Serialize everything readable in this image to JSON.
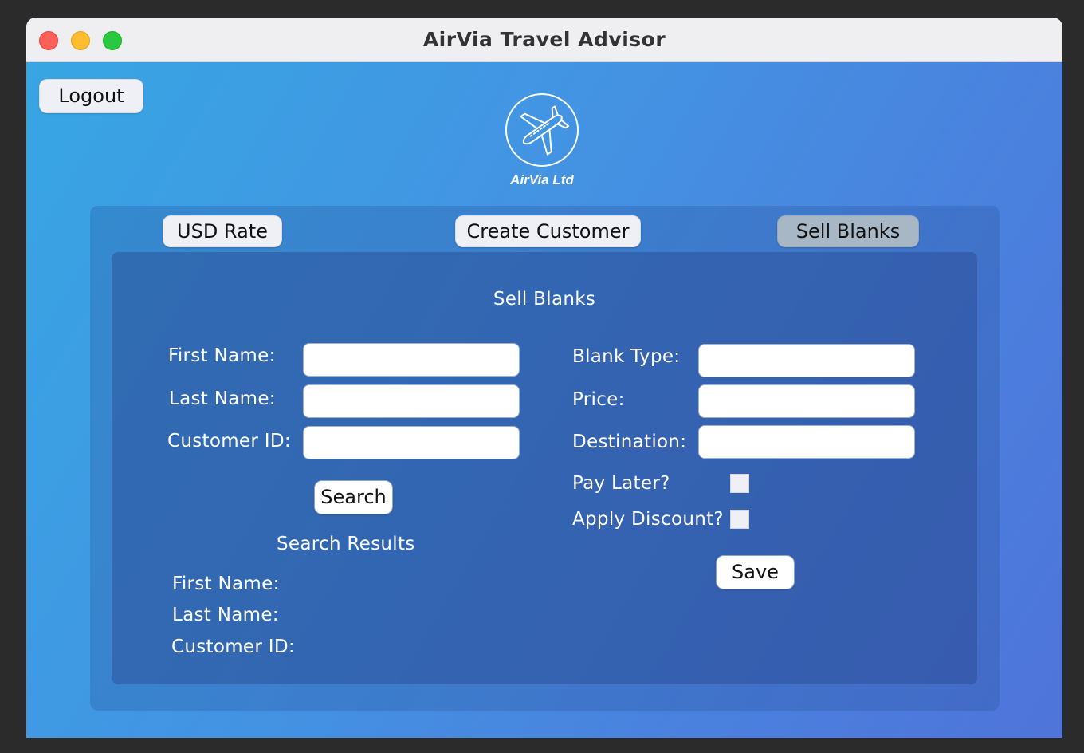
{
  "window": {
    "title": "AirVia Travel Advisor"
  },
  "header": {
    "logout_label": "Logout",
    "logo_text": "AirVia Ltd"
  },
  "tabs": [
    {
      "label": "USD Rate"
    },
    {
      "label": "Create Customer"
    },
    {
      "label": "Sell Blanks",
      "active": true
    }
  ],
  "panel": {
    "title": "Sell Blanks",
    "customer_form": {
      "first_name_label": "First Name:",
      "first_name_value": "",
      "last_name_label": "Last Name:",
      "last_name_value": "",
      "customer_id_label": "Customer ID:",
      "customer_id_value": "",
      "search_label": "Search"
    },
    "search_results": {
      "title": "Search Results",
      "first_name_label": "First Name:",
      "last_name_label": "Last Name:",
      "customer_id_label": "Customer ID:"
    },
    "blank_form": {
      "blank_type_label": "Blank Type:",
      "blank_type_value": "",
      "price_label": "Price:",
      "price_value": "",
      "destination_label": "Destination:",
      "destination_value": "",
      "pay_later_label": "Pay Later?",
      "pay_later_checked": false,
      "apply_discount_label": "Apply Discount?",
      "apply_discount_checked": false,
      "save_label": "Save"
    }
  },
  "colors": {
    "gradient_start": "#37a6e3",
    "gradient_end": "#4f74da",
    "active_tab": "#a8b7c6",
    "button_bg": "#eef0f6"
  },
  "icons": {
    "logo": "airplane-circle-icon"
  }
}
